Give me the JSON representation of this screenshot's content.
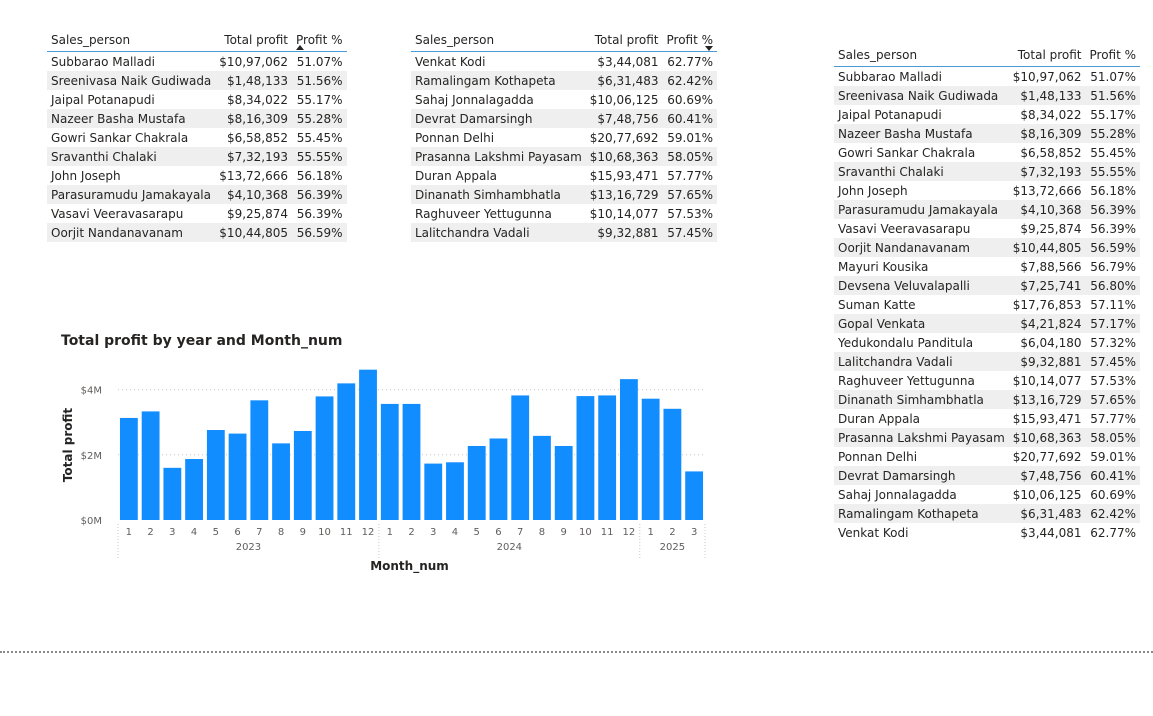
{
  "tables": [
    {
      "headers": [
        "Sales_person",
        "Total profit",
        "Profit %"
      ],
      "sort": "asc",
      "rows": [
        [
          "Subbarao Malladi",
          "$10,97,062",
          "51.07%"
        ],
        [
          "Sreenivasa Naik Gudiwada",
          "$1,48,133",
          "51.56%"
        ],
        [
          "Jaipal Potanapudi",
          "$8,34,022",
          "55.17%"
        ],
        [
          "Nazeer Basha Mustafa",
          "$8,16,309",
          "55.28%"
        ],
        [
          "Gowri Sankar Chakrala",
          "$6,58,852",
          "55.45%"
        ],
        [
          "Sravanthi Chalaki",
          "$7,32,193",
          "55.55%"
        ],
        [
          "John Joseph",
          "$13,72,666",
          "56.18%"
        ],
        [
          "Parasuramudu Jamakayala",
          "$4,10,368",
          "56.39%"
        ],
        [
          "Vasavi Veeravasarapu",
          "$9,25,874",
          "56.39%"
        ],
        [
          "Oorjit Nandanavanam",
          "$10,44,805",
          "56.59%"
        ]
      ]
    },
    {
      "headers": [
        "Sales_person",
        "Total profit",
        "Profit %"
      ],
      "sort": "desc",
      "rows": [
        [
          "Venkat Kodi",
          "$3,44,081",
          "62.77%"
        ],
        [
          "Ramalingam Kothapeta",
          "$6,31,483",
          "62.42%"
        ],
        [
          "Sahaj Jonnalagadda",
          "$10,06,125",
          "60.69%"
        ],
        [
          "Devrat Damarsingh",
          "$7,48,756",
          "60.41%"
        ],
        [
          "Ponnan Delhi",
          "$20,77,692",
          "59.01%"
        ],
        [
          "Prasanna Lakshmi Payasam",
          "$10,68,363",
          "58.05%"
        ],
        [
          "Duran Appala",
          "$15,93,471",
          "57.77%"
        ],
        [
          "Dinanath Simhambhatla",
          "$13,16,729",
          "57.65%"
        ],
        [
          "Raghuveer Yettugunna",
          "$10,14,077",
          "57.53%"
        ],
        [
          "Lalitchandra Vadali",
          "$9,32,881",
          "57.45%"
        ]
      ]
    },
    {
      "headers": [
        "Sales_person",
        "Total profit",
        "Profit %"
      ],
      "sort": "none",
      "rows": [
        [
          "Subbarao Malladi",
          "$10,97,062",
          "51.07%"
        ],
        [
          "Sreenivasa Naik Gudiwada",
          "$1,48,133",
          "51.56%"
        ],
        [
          "Jaipal Potanapudi",
          "$8,34,022",
          "55.17%"
        ],
        [
          "Nazeer Basha Mustafa",
          "$8,16,309",
          "55.28%"
        ],
        [
          "Gowri Sankar Chakrala",
          "$6,58,852",
          "55.45%"
        ],
        [
          "Sravanthi Chalaki",
          "$7,32,193",
          "55.55%"
        ],
        [
          "John Joseph",
          "$13,72,666",
          "56.18%"
        ],
        [
          "Parasuramudu Jamakayala",
          "$4,10,368",
          "56.39%"
        ],
        [
          "Vasavi Veeravasarapu",
          "$9,25,874",
          "56.39%"
        ],
        [
          "Oorjit Nandanavanam",
          "$10,44,805",
          "56.59%"
        ],
        [
          "Mayuri Kousika",
          "$7,88,566",
          "56.79%"
        ],
        [
          "Devsena Veluvalapalli",
          "$7,25,741",
          "56.80%"
        ],
        [
          "Suman Katte",
          "$17,76,853",
          "57.11%"
        ],
        [
          "Gopal Venkata",
          "$4,21,824",
          "57.17%"
        ],
        [
          "Yedukondalu Panditula",
          "$6,04,180",
          "57.32%"
        ],
        [
          "Lalitchandra Vadali",
          "$9,32,881",
          "57.45%"
        ],
        [
          "Raghuveer Yettugunna",
          "$10,14,077",
          "57.53%"
        ],
        [
          "Dinanath Simhambhatla",
          "$13,16,729",
          "57.65%"
        ],
        [
          "Duran Appala",
          "$15,93,471",
          "57.77%"
        ],
        [
          "Prasanna Lakshmi Payasam",
          "$10,68,363",
          "58.05%"
        ],
        [
          "Ponnan Delhi",
          "$20,77,692",
          "59.01%"
        ],
        [
          "Devrat Damarsingh",
          "$7,48,756",
          "60.41%"
        ],
        [
          "Sahaj Jonnalagadda",
          "$10,06,125",
          "60.69%"
        ],
        [
          "Ramalingam Kothapeta",
          "$6,31,483",
          "62.42%"
        ],
        [
          "Venkat Kodi",
          "$3,44,081",
          "62.77%"
        ]
      ]
    }
  ],
  "chart_data": {
    "type": "bar",
    "title": "Total profit by year and Month_num",
    "xlabel": "Month_num",
    "ylabel": "Total profit",
    "ylim": [
      0,
      4.6
    ],
    "yticks": [
      0,
      2,
      4
    ],
    "ytick_labels": [
      "$0M",
      "$2M",
      "$4M"
    ],
    "grid": true,
    "color": "#118DFF",
    "years": [
      {
        "label": "2023",
        "months": [
          "1",
          "2",
          "3",
          "4",
          "5",
          "6",
          "7",
          "8",
          "9",
          "10",
          "11",
          "12"
        ]
      },
      {
        "label": "2024",
        "months": [
          "1",
          "2",
          "3",
          "4",
          "5",
          "6",
          "7",
          "8",
          "9",
          "10",
          "11",
          "12"
        ]
      },
      {
        "label": "2025",
        "months": [
          "1",
          "2",
          "3"
        ]
      }
    ],
    "values": [
      3.13,
      3.33,
      1.6,
      1.87,
      2.76,
      2.65,
      3.67,
      2.35,
      2.73,
      3.79,
      4.19,
      4.61,
      3.56,
      3.56,
      1.73,
      1.77,
      2.27,
      2.5,
      3.82,
      2.58,
      2.27,
      3.8,
      3.82,
      4.32,
      3.72,
      3.41,
      1.49
    ]
  }
}
